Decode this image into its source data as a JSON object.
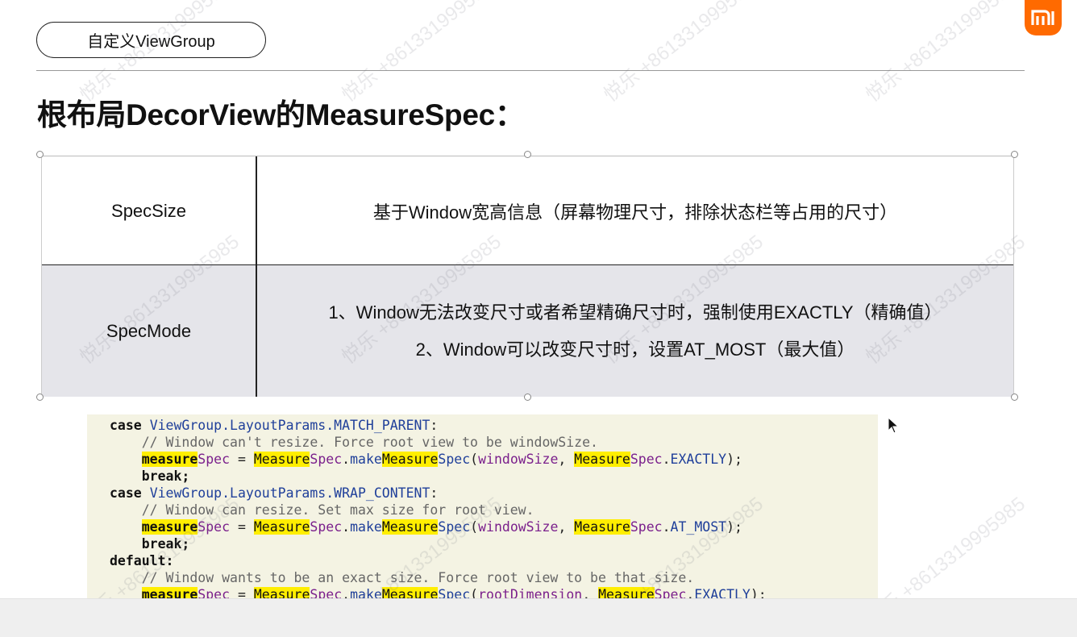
{
  "header": {
    "section_pill": "自定义ViewGroup",
    "title": "根布局DecorView的MeasureSpec："
  },
  "brand": {
    "logo_text": "mi",
    "color": "#ff6a00"
  },
  "table": {
    "rows": [
      {
        "label": "SpecSize",
        "lines": [
          "基于Window宽高信息（屏幕物理尺寸，排除状态栏等占用的尺寸）"
        ]
      },
      {
        "label": "SpecMode",
        "lines": [
          "1、Window无法改变尺寸或者希望精确尺寸时，强制使用EXACTLY（精确值）",
          "2、Window可以改变尺寸时，设置AT_MOST（最大值）"
        ]
      }
    ]
  },
  "code": {
    "case1_keyword": "case",
    "case1_value": "ViewGroup.LayoutParams.MATCH_PARENT",
    "case1_comment": "// Window can't resize. Force root view to be windowSize.",
    "case1_arg": "windowSize",
    "case1_mode": "EXACTLY",
    "case2_keyword": "case",
    "case2_value": "ViewGroup.LayoutParams.WRAP_CONTENT",
    "case2_comment": "// Window can resize. Set max size for root view.",
    "case2_arg": "windowSize",
    "case2_mode": "AT_MOST",
    "default_keyword": "default:",
    "default_comment": "// Window wants to be an exact size. Force root view to be that size.",
    "default_arg": "rootDimension",
    "default_mode": "EXACTLY",
    "break_stmt": "break;",
    "var_a": "measure",
    "var_b": "Spec",
    "cls_a": "Measure",
    "method_pre": "make",
    "method_mid": "Measure"
  },
  "watermark": {
    "text": "悦乐 +8613319995985"
  }
}
